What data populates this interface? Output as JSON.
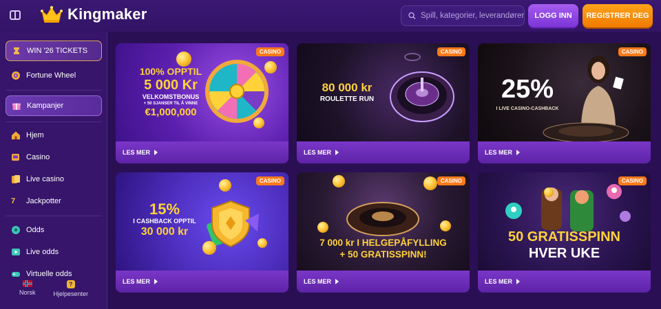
{
  "header": {
    "brand": "Kingmaker",
    "search_placeholder": "Spill, kategorier, leverandører",
    "login_label": "LOGG INN",
    "register_label": "REGISTRER DEG"
  },
  "sidebar": {
    "items": [
      {
        "label": "WIN '26 TICKETS",
        "icon": "ticket-icon"
      },
      {
        "label": "Fortune Wheel",
        "icon": "wheel-icon"
      },
      {
        "label": "Kampanjer",
        "icon": "gift-icon"
      },
      {
        "label": "Hjem",
        "icon": "home-icon"
      },
      {
        "label": "Casino",
        "icon": "slot-icon"
      },
      {
        "label": "Live casino",
        "icon": "cards-icon"
      },
      {
        "label": "Jackpotter",
        "icon": "jackpot-icon"
      },
      {
        "label": "Odds",
        "icon": "ball-icon"
      },
      {
        "label": "Live odds",
        "icon": "play-icon"
      },
      {
        "label": "Virtuelle odds",
        "icon": "gamepad-icon"
      }
    ],
    "footer": [
      {
        "label": "Norsk",
        "icon": "flag-icon"
      },
      {
        "label": "Hjelpesenter",
        "icon": "help-icon"
      }
    ]
  },
  "cards": [
    {
      "badge": "CASINO",
      "cta": "LES MER",
      "line1": "100% OPPTIL",
      "line2": "5 000 Kr",
      "line3": "VELKOMSTBONUS",
      "line4": "+ 50 SJANSER TIL Å VINNE",
      "line5": "€1,000,000"
    },
    {
      "badge": "CASINO",
      "cta": "LES MER",
      "line1": "80 000 kr",
      "line2": "ROULETTE RUN"
    },
    {
      "badge": "CASINO",
      "cta": "LES MER",
      "line1": "25%",
      "line2": "I LIVE CASINO-CASHBACK"
    },
    {
      "badge": "CASINO",
      "cta": "LES MER",
      "line1": "15%",
      "line2": "I CASHBACK OPPTIL",
      "line3": "30 000 kr"
    },
    {
      "badge": "CASINO",
      "cta": "LES MER",
      "line1": "7 000 kr I HELGEPÅFYLLING",
      "line2": "+ 50 GRATISSPINN!"
    },
    {
      "badge": "CASINO",
      "cta": "LES MER",
      "line1": "50 GRATISSPINN",
      "line2": "HVER UKE"
    }
  ],
  "colors": {
    "accent_purple": "#7b34d6",
    "accent_orange": "#f07a00",
    "gold_text": "#ffd23a",
    "badge_orange": "#ff7a1a"
  }
}
